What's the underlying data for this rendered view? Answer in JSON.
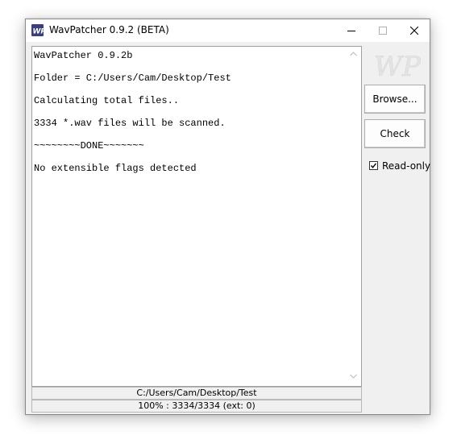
{
  "window": {
    "title": "WavPatcher 0.9.2 (BETA)",
    "controls": {
      "minimize_icon": "minimize-icon",
      "maximize_icon": "maximize-icon",
      "close_icon": "close-icon"
    }
  },
  "console": {
    "lines": [
      "WavPatcher 0.9.2b",
      "Folder = C:/Users/Cam/Desktop/Test",
      "Calculating total files..",
      "3334 *.wav files will be scanned.",
      "~~~~~~~~DONE~~~~~~~",
      "No extensible flags detected"
    ]
  },
  "status": {
    "path": "C:/Users/Cam/Desktop/Test",
    "progress": "100% : 3334/3334 (ext: 0)"
  },
  "sidebar": {
    "logo_text": "WP",
    "browse_label": "Browse...",
    "check_label": "Check",
    "readonly_label": "Read-only",
    "readonly_checked": true
  },
  "colors": {
    "window_bg": "#f0f0f0",
    "console_bg": "#ffffff",
    "logo": "#e4e4e4"
  }
}
